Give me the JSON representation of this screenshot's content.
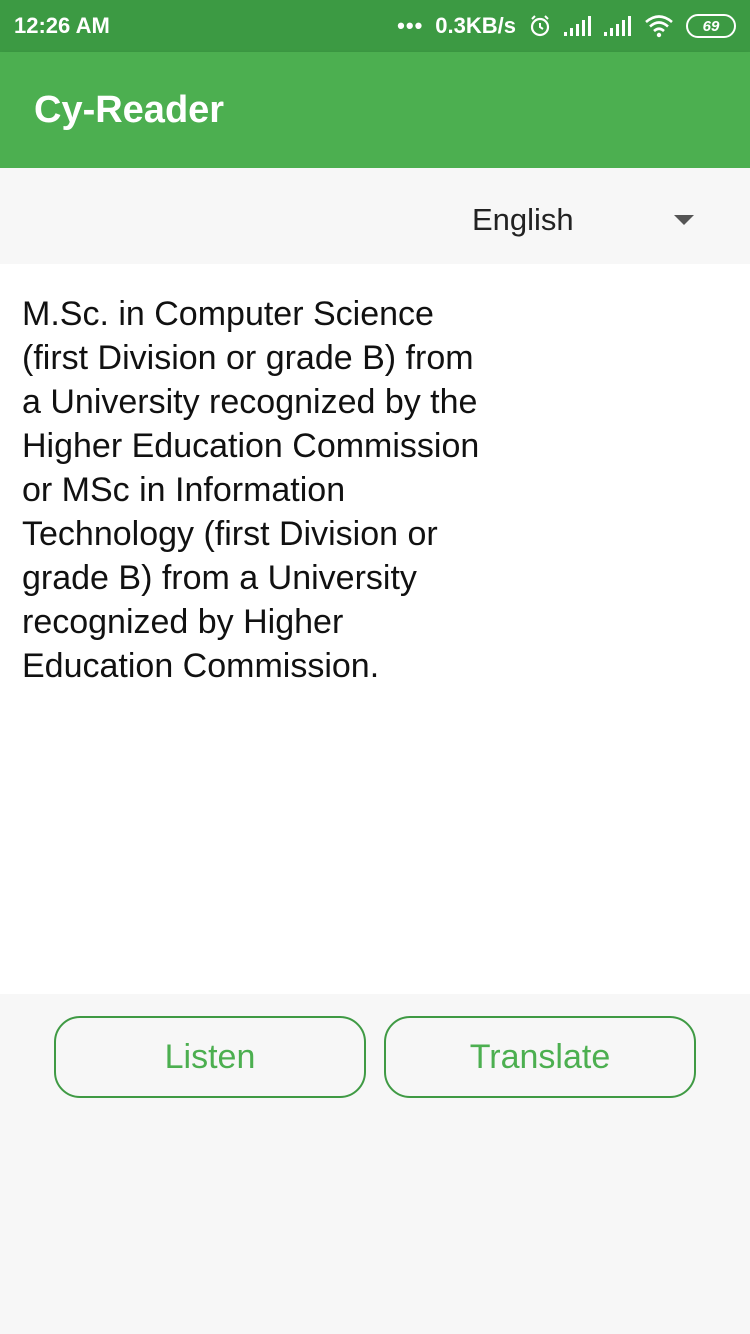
{
  "status_bar": {
    "time": "12:26 AM",
    "dots": "•••",
    "network_speed": "0.3KB/s",
    "battery": "69",
    "icons": [
      "alarm-icon",
      "signal-icon",
      "signal-icon",
      "wifi-icon",
      "battery-icon"
    ]
  },
  "app_bar": {
    "title": "Cy-Reader",
    "background_color": "#4caf50"
  },
  "language_selector": {
    "selected": "English"
  },
  "main_text": "M.Sc. in Computer Science (first Division or grade B) from a University recognized by the Higher Education Commission or MSc in Information Technology (first Division or grade B) from a University recognized by Higher Education Commission.",
  "buttons": {
    "listen": "Listen",
    "translate": "Translate",
    "accent_color": "#4caf50"
  }
}
